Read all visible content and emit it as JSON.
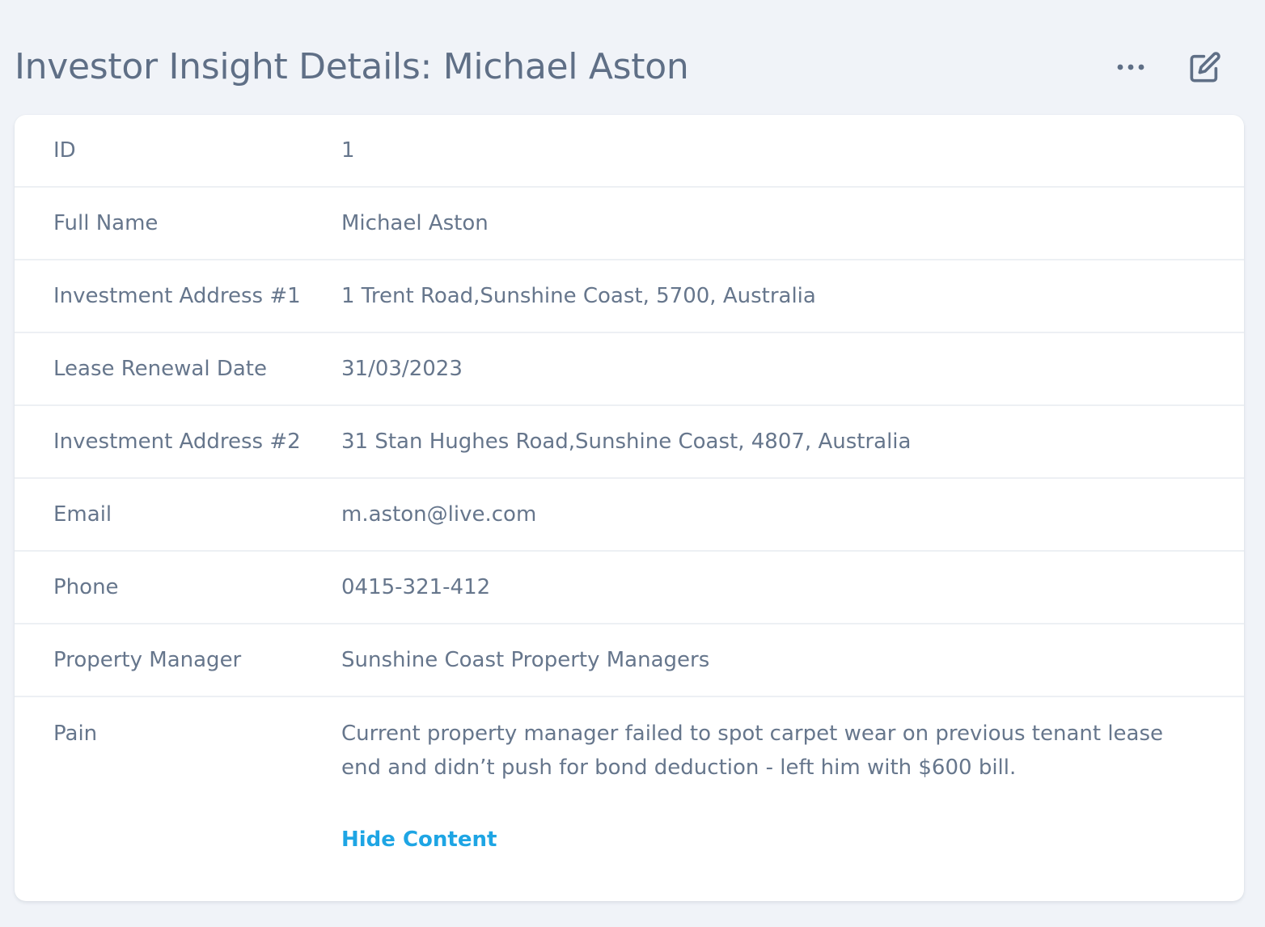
{
  "header": {
    "title": "Investor Insight Details: Michael Aston",
    "more_icon": "more-horizontal-icon",
    "edit_icon": "edit-icon"
  },
  "details": {
    "id": {
      "label": "ID",
      "value": "1"
    },
    "full_name": {
      "label": "Full Name",
      "value": "Michael Aston"
    },
    "address_1": {
      "label": "Investment Address #1",
      "value": "1 Trent Road,Sunshine Coast, 5700, Australia"
    },
    "lease_renewal": {
      "label": "Lease Renewal Date",
      "value": "31/03/2023"
    },
    "address_2": {
      "label": "Investment Address #2",
      "value": "31 Stan Hughes Road,Sunshine Coast, 4807, Australia"
    },
    "email": {
      "label": "Email",
      "value": "m.aston@live.com"
    },
    "phone": {
      "label": "Phone",
      "value": "0415-321-412"
    },
    "property_manager": {
      "label": "Property Manager",
      "value": "Sunshine Coast Property Managers"
    },
    "pain": {
      "label": "Pain",
      "value": "Current property manager failed to spot carpet wear on previous tenant lease end and didn’t push for bond deduction - left him with $600 bill.",
      "toggle_label": "Hide Content"
    }
  },
  "colors": {
    "background": "#f0f3f8",
    "text": "#5f6f86",
    "link": "#1ea5e4",
    "divider": "#edf0f4"
  }
}
